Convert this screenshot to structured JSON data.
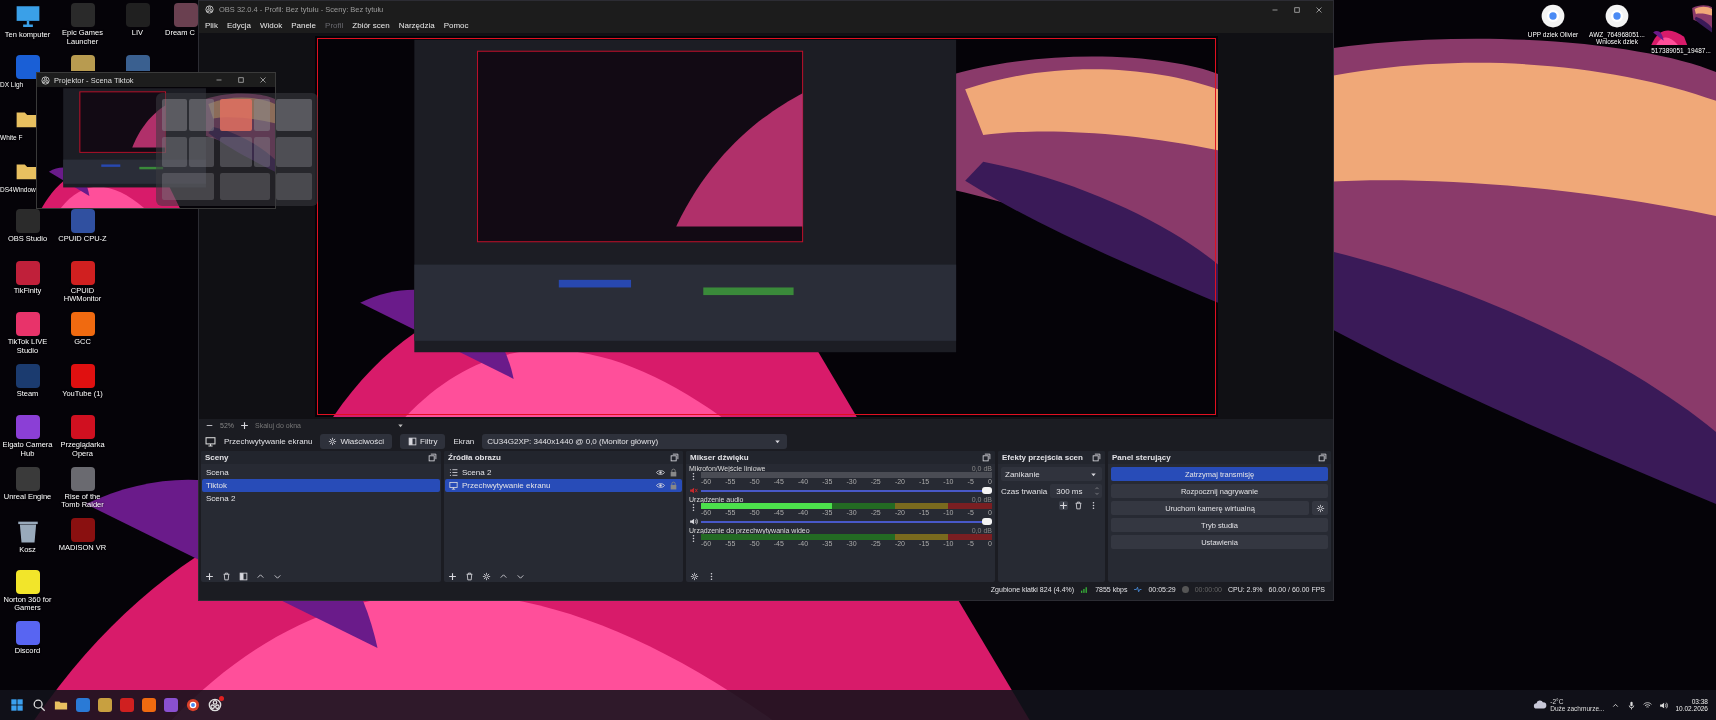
{
  "desktop": {
    "columns": [
      {
        "icons": [
          {
            "kind": "computer",
            "label": "Ten komputer"
          },
          {
            "kind": "app",
            "color": "#1a5fd6",
            "label": "DX Ligh"
          },
          {
            "kind": "folder",
            "label": "White F"
          },
          {
            "kind": "folder",
            "label": "DS4Window"
          },
          {
            "kind": "app",
            "color": "#2b2b2b",
            "label": "OBS Studio"
          },
          {
            "kind": "app",
            "color": "#c0203a",
            "label": "TikFinity"
          },
          {
            "kind": "app",
            "color": "#e8336a",
            "label": "TikTok LIVE Studio"
          },
          {
            "kind": "app",
            "color": "#1b3b6f",
            "label": "Steam"
          },
          {
            "kind": "app",
            "color": "#8b3fd6",
            "label": "Elgato Camera Hub"
          },
          {
            "kind": "app",
            "color": "#3a3a3a",
            "label": "Unreal Engine"
          },
          {
            "kind": "bin",
            "label": "Kosz"
          },
          {
            "kind": "app",
            "color": "#f2e52a",
            "label": "Norton 360 for Gamers"
          },
          {
            "kind": "app",
            "color": "#5865f2",
            "label": "Discord"
          }
        ]
      },
      {
        "icons": [
          {
            "kind": "app",
            "color": "#2a2a2a",
            "label": "Epic Games Launcher"
          },
          {
            "kind": "app",
            "color": "#b89b50"
          },
          {
            "kind": "gap"
          },
          {
            "kind": "gap"
          },
          {
            "kind": "app",
            "color": "#3050a0",
            "label": "CPUID CPU-Z"
          },
          {
            "kind": "app",
            "color": "#d02020",
            "label": "CPUID HWMonitor"
          },
          {
            "kind": "app",
            "color": "#f06a10",
            "label": "GCC"
          },
          {
            "kind": "app",
            "color": "#e01010",
            "label": "YouTube (1)"
          },
          {
            "kind": "app",
            "color": "#d01020",
            "label": "Przeglądarka Opera"
          },
          {
            "kind": "app",
            "color": "#6a6a70",
            "label": "Rise of the Tomb Raider"
          },
          {
            "kind": "app",
            "color": "#8a1010",
            "label": "MADISON VR"
          }
        ]
      },
      {
        "icons": [
          {
            "kind": "app",
            "color": "#202020",
            "label": "LIV"
          },
          {
            "kind": "app",
            "color": "#3a6090"
          }
        ]
      },
      {
        "icons": [
          {
            "kind": "app",
            "color": "#6a4050",
            "label": "Dream C"
          }
        ]
      }
    ]
  },
  "desktop_right": [
    {
      "kind": "file",
      "label": "UPP dziek Olivier"
    },
    {
      "kind": "file",
      "label": "AWZ_764968051... Wniosek dziek"
    },
    {
      "label": "517389051_19487..."
    }
  ],
  "projector": {
    "title": "Projektor - Scena Tiktok"
  },
  "obs": {
    "title": "OBS 32.0.4 - Profil: Bez tytułu - Sceny: Bez tytułu",
    "menu": [
      {
        "label": "Plik",
        "disabled": false
      },
      {
        "label": "Edycja",
        "disabled": false
      },
      {
        "label": "Widok",
        "disabled": false
      },
      {
        "label": "Panele",
        "disabled": false
      },
      {
        "label": "Profil",
        "disabled": true
      },
      {
        "label": "Zbiór scen",
        "disabled": false
      },
      {
        "label": "Narzędzia",
        "disabled": false
      },
      {
        "label": "Pomoc",
        "disabled": false
      }
    ],
    "zoom": {
      "value": "52%",
      "mode": "Skaluj do okna"
    },
    "source_toolbar": {
      "source": "Przechwytywanie ekranu",
      "properties": "Właściwości",
      "filters": "Filtry",
      "display_label": "Ekran",
      "display": "CU34G2XP: 3440x1440 @ 0,0 (Monitor główny)"
    },
    "scenes": {
      "title": "Sceny",
      "items": [
        {
          "label": "Scena",
          "selected": false
        },
        {
          "label": "Tiktok",
          "selected": true
        },
        {
          "label": "Scena 2",
          "selected": false
        }
      ]
    },
    "sources": {
      "title": "Źródła obrazu",
      "items": [
        {
          "label": "Scena 2",
          "kind": "scene",
          "visible": true,
          "selected": false
        },
        {
          "label": "Przechwytywanie ekranu",
          "kind": "display",
          "visible": true,
          "selected": true
        }
      ]
    },
    "mixer": {
      "title": "Mikser dźwięku",
      "channels": [
        {
          "name": "Mikrofon/Wejście liniowe",
          "reading": "0,0 dB",
          "muted": true,
          "meter": {
            "level": 0
          },
          "volume": {
            "level": 1
          },
          "scale": [
            "-60",
            "-55",
            "-50",
            "-45",
            "-40",
            "-35",
            "-30",
            "-25",
            "-20",
            "-15",
            "-10",
            "-5",
            "0"
          ]
        },
        {
          "name": "Urządzenie audio",
          "reading": "0,0 dB",
          "muted": false,
          "meter": {
            "level": 0.45
          },
          "volume": {
            "level": 1
          },
          "scale": [
            "-60",
            "-55",
            "-50",
            "-45",
            "-40",
            "-35",
            "-30",
            "-25",
            "-20",
            "-15",
            "-10",
            "-5",
            "0"
          ]
        },
        {
          "name": "Urządzenie do przechwytywania wideo",
          "reading": "0,0 dB",
          "muted": false,
          "scale": [
            "-60",
            "-55",
            "-50",
            "-45",
            "-40",
            "-35",
            "-30",
            "-25",
            "-20",
            "-15",
            "-10",
            "-5",
            "0"
          ]
        }
      ]
    },
    "transitions": {
      "title": "Efekty przejścia scen",
      "transition": "Zanikanie",
      "duration_label": "Czas trwania",
      "duration": "300 ms"
    },
    "controls": {
      "title": "Panel sterujący",
      "buttons": [
        {
          "label": "Zatrzymaj transmisję",
          "active": true,
          "settings": false
        },
        {
          "label": "Rozpocznij nagrywanie",
          "active": false,
          "settings": false
        },
        {
          "label": "Uruchom kamerę wirtualną",
          "active": false,
          "settings": true
        },
        {
          "label": "Tryb studia",
          "active": false,
          "settings": false
        },
        {
          "label": "Ustawienia",
          "active": false,
          "settings": false
        }
      ]
    },
    "status": {
      "dropped": "Zgubione klatki 824 (4.4%)",
      "bitrate": "7855 kbps",
      "stream_time": "00:05:29",
      "record_time": "00:00:00",
      "cpu": "CPU: 2.9%",
      "fps": "60.00 / 60.00 FPS"
    }
  },
  "taskbar": {
    "apps": [
      {
        "kind": "start"
      },
      {
        "kind": "search"
      },
      {
        "kind": "folder"
      },
      {
        "kind": "app",
        "color": "#2a7ad6"
      },
      {
        "kind": "app",
        "color": "#c8a040"
      },
      {
        "kind": "app",
        "color": "#d02020"
      },
      {
        "kind": "app",
        "color": "#f06a10"
      },
      {
        "kind": "app",
        "color": "#8a50d0"
      },
      {
        "kind": "chrome"
      },
      {
        "kind": "obs",
        "badge": true
      }
    ],
    "weather": {
      "temperature": "-2°C",
      "condition": "Duże zachmurze..."
    },
    "time": "03:38",
    "date": "10.02.2026"
  }
}
